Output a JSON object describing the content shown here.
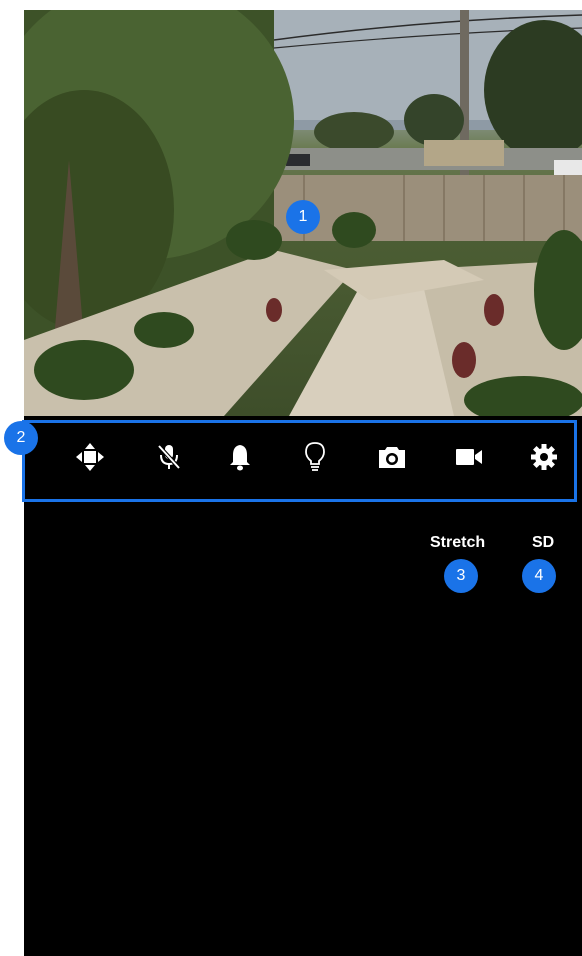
{
  "camera": {
    "name": "garden-camera-feed"
  },
  "toolbar": {
    "buttons": [
      {
        "icon": "move-arrows-icon"
      },
      {
        "icon": "mic-off-icon"
      },
      {
        "icon": "bell-icon"
      },
      {
        "icon": "lightbulb-icon"
      },
      {
        "icon": "camera-icon"
      },
      {
        "icon": "video-camera-icon"
      },
      {
        "icon": "gear-icon"
      }
    ]
  },
  "options": {
    "stretch_label": "Stretch",
    "quality_label": "SD"
  },
  "markers": {
    "m1": "1",
    "m2": "2",
    "m3": "3",
    "m4": "4"
  },
  "colors": {
    "accent": "#1a73e8",
    "background": "#000000",
    "icon": "#ffffff"
  }
}
